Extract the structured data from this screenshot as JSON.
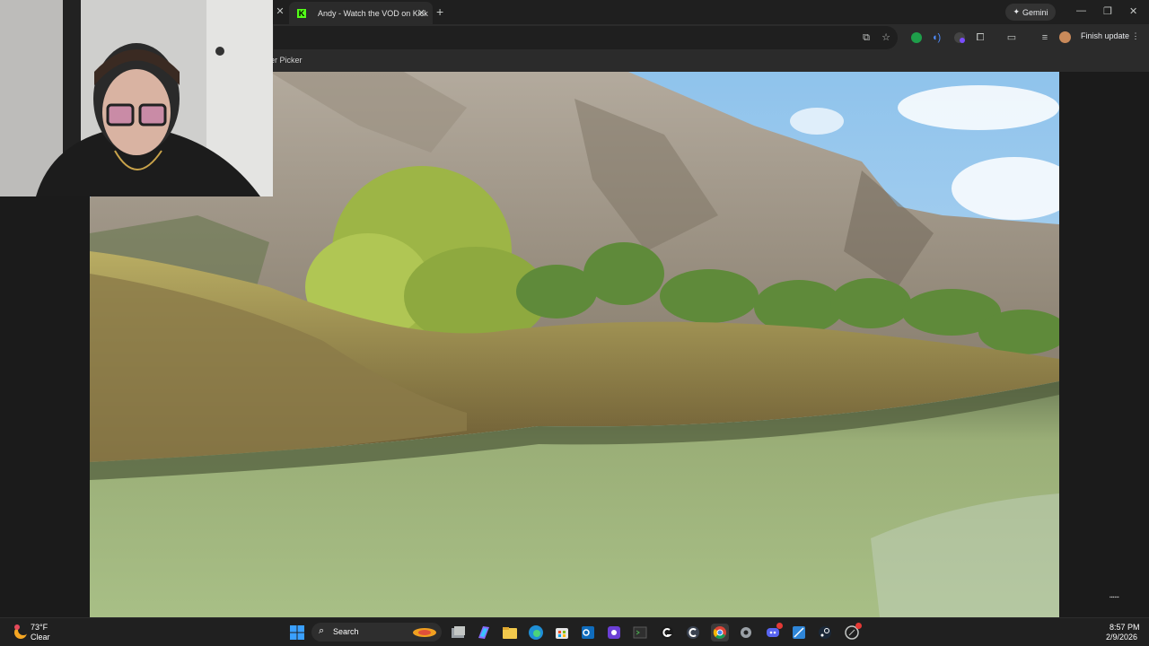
{
  "browser": {
    "tab_title": "Andy - Watch the VOD on Kick",
    "gemini_label": "Gemini",
    "finish_update_label": "Finish update",
    "bookmark_label": "er Picker"
  },
  "taskbar": {
    "weather_temp": "73°F",
    "weather_condition": "Clear",
    "search_label": "Search",
    "time": "8:57 PM",
    "date": "2/9/2026"
  },
  "colors": {
    "chrome_dark": "#1f1f1f",
    "toolbar": "#2b2b2b",
    "taskbar": "#202020",
    "kick_green": "#53fc18"
  }
}
